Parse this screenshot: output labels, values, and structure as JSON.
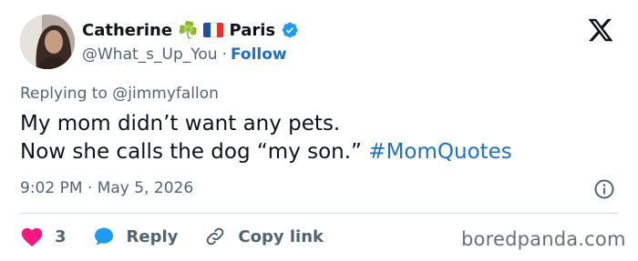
{
  "author": {
    "display_name": "Catherine",
    "emoji_clover": "☘️",
    "emoji_flag": "🇫🇷",
    "location": "Paris",
    "handle": "@What_s_Up_You",
    "separator": "·",
    "follow_label": "Follow"
  },
  "reply_to": {
    "prefix": "Replying to",
    "mention": "@jimmyfallon"
  },
  "tweet": {
    "line1": "My mom didn’t want any pets.",
    "line2": "Now she calls the dog “my son.”",
    "hashtag": "#MomQuotes"
  },
  "meta": {
    "time": "9:02 PM",
    "separator": "·",
    "date": "May 5, 2026"
  },
  "actions": {
    "like_count": "3",
    "reply_label": "Reply",
    "copy_label": "Copy link"
  },
  "watermark": "boredpanda.com",
  "colors": {
    "accent": "#1d70c4",
    "like": "#f91880",
    "reply_icon": "#1d9bf0",
    "muted": "#536471",
    "divider": "#cfd9de"
  },
  "icons": {
    "x_logo": "x-logo-icon",
    "verified": "verified-badge-icon",
    "info": "info-icon",
    "like": "heart-icon",
    "reply": "speech-bubble-icon",
    "copy": "link-icon"
  }
}
